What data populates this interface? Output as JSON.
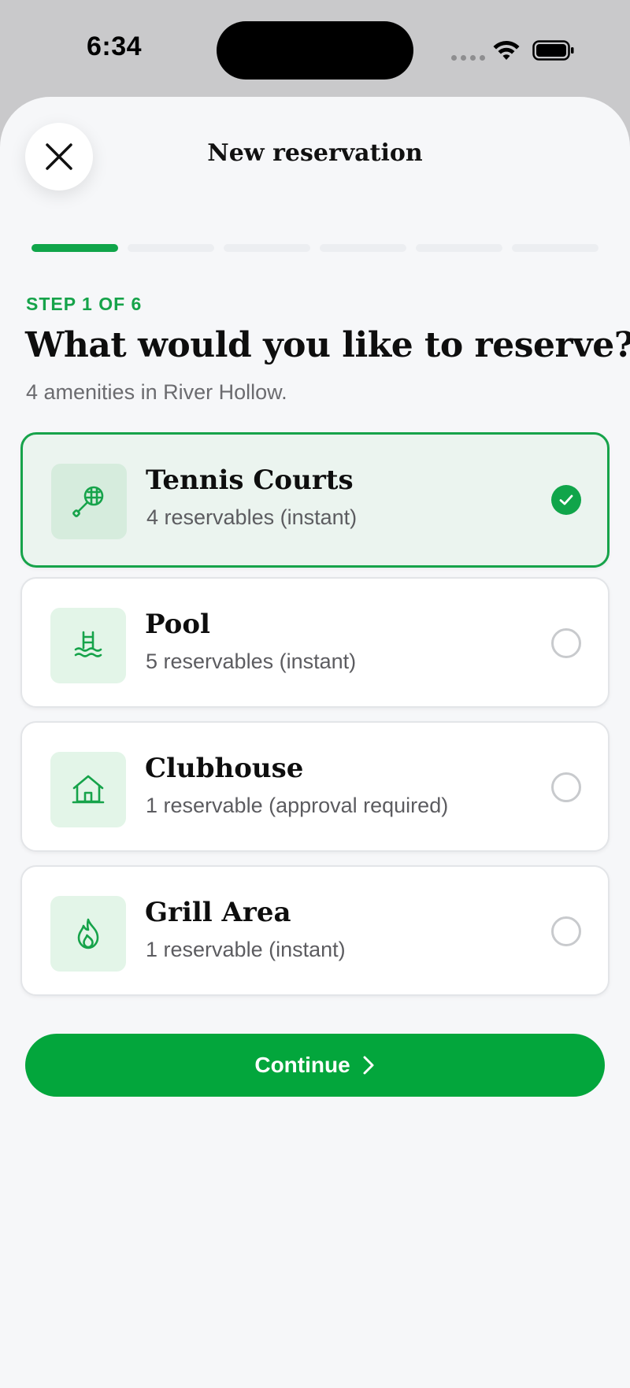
{
  "status_bar": {
    "time": "6:34"
  },
  "sheet": {
    "title": "New reservation",
    "close_icon": "close-icon"
  },
  "progress": {
    "current_step": 1,
    "total_steps": 6
  },
  "step_label": "STEP 1 OF 6",
  "question": "What would you like to reserve?",
  "subtitle": "4 amenities in River Hollow.",
  "options": [
    {
      "title": "Tennis Courts",
      "subtitle": "4 reservables (instant)",
      "icon": "tennis-racket-icon",
      "selected": true
    },
    {
      "title": "Pool",
      "subtitle": "5 reservables (instant)",
      "icon": "pool-ladder-icon",
      "selected": false
    },
    {
      "title": "Clubhouse",
      "subtitle": "1 reservable (approval required)",
      "icon": "house-icon",
      "selected": false
    },
    {
      "title": "Grill Area",
      "subtitle": "1 reservable (instant)",
      "icon": "flame-icon",
      "selected": false
    }
  ],
  "continue_button": {
    "label": "Continue",
    "icon": "chevron-right-icon"
  },
  "colors": {
    "accent": "#10a54a",
    "button": "#03a63c",
    "selected_card_bg": "#ebf4ef",
    "icon_tile_bg": "#e3f5e8",
    "sheet_bg": "#f6f7f9"
  }
}
